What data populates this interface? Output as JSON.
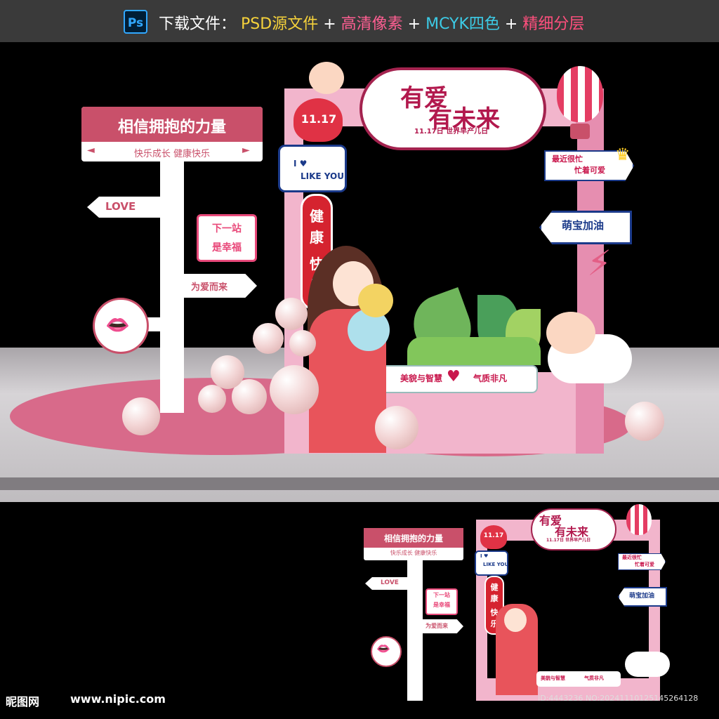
{
  "header": {
    "ps_icon": "Ps",
    "label": "下载文件：",
    "psd": "PSD源文件",
    "plus": "+",
    "hd": "高清像素",
    "mcyk": "MCYK四色",
    "layers": "精细分层"
  },
  "signpost": {
    "title": "相信拥抱的力量",
    "subtitle": "快乐成长   健康快乐",
    "arrow_left": "◄",
    "arrow_right": "►",
    "love": "LOVE",
    "next_line1": "下一站",
    "next_line2": "是幸福",
    "for_love": "为爱而来",
    "lips_icon": "lips-icon"
  },
  "frame": {
    "cloud_line1": "有爱",
    "cloud_line2": "有未来",
    "cloud_line3": "11.17日 世界早产儿日",
    "heart_date": "11.17",
    "like_line1": "I ♥",
    "like_line2": "LIKE YOU",
    "band_chars": [
      "健",
      "康",
      "快",
      "乐"
    ],
    "busy_line1": "最近很忙",
    "busy_line2": "忙着可爱",
    "cute_sign": "萌宝加油",
    "ribbon_left": "美貌与智慧",
    "ribbon_right": "气质非凡",
    "ribbon_heart": "♥"
  },
  "watermark": {
    "brand": "昵图网",
    "url": "www.nipic.com",
    "id_text": "ID:4443236 NO:20241110125145264128"
  },
  "colors": {
    "accent_pink": "#c9506a",
    "frame_pink": "#f2b5cc",
    "title_red": "#b2184d",
    "navy": "#1b3a8a"
  }
}
